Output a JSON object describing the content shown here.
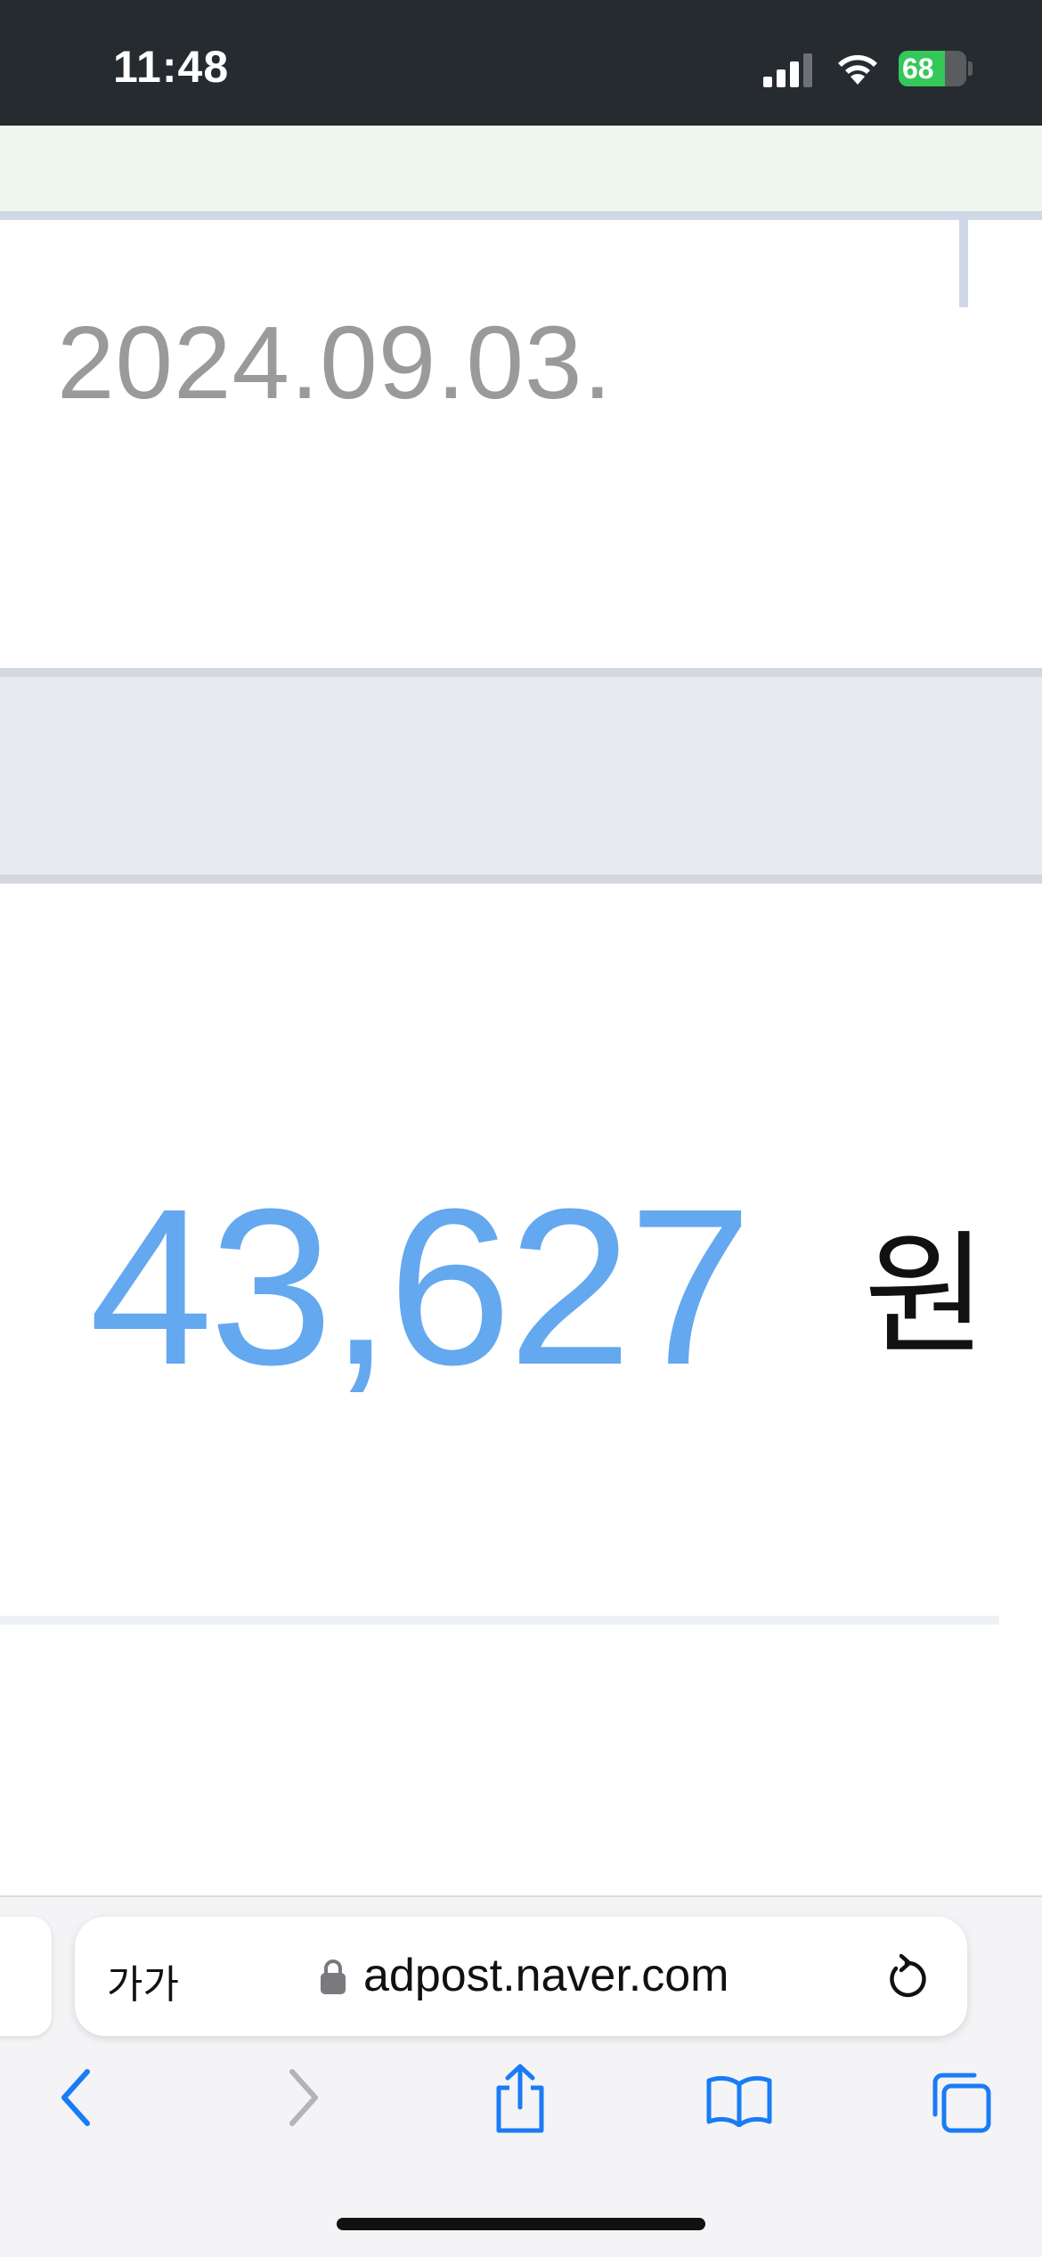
{
  "status_bar": {
    "time": "11:48",
    "battery_level": "68",
    "battery_fill_fraction": 0.68,
    "icons": [
      "signal-icon",
      "wifi-icon",
      "battery-charging-icon"
    ]
  },
  "content": {
    "date": "2024.09.03.",
    "amount": "43,627",
    "currency_unit": "원",
    "amount_color": "#64a8ef"
  },
  "browser": {
    "text_size_label": "가가",
    "url": "adpost.naver.com",
    "icons": [
      "lock-icon",
      "reload-icon",
      "back-icon",
      "forward-icon",
      "share-icon",
      "bookmarks-icon",
      "tabs-icon"
    ],
    "accent_color": "#1a7cf5"
  }
}
